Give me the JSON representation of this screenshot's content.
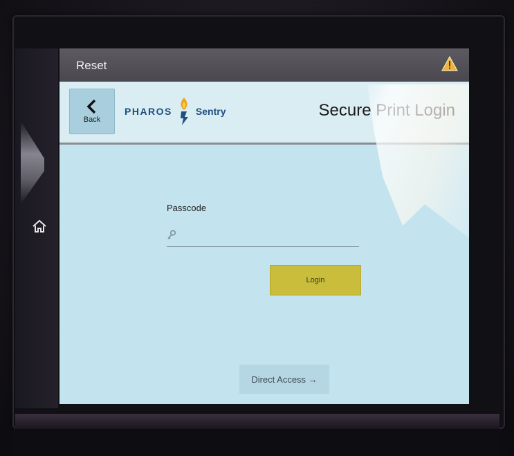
{
  "topbar": {
    "reset_label": "Reset",
    "warning_icon": "warning-triangle-icon"
  },
  "header": {
    "back_label": "Back",
    "back_icon": "chevron-left-icon",
    "logo": {
      "brand": "PHAROS",
      "product": "Sentry",
      "icon": "torch-icon"
    },
    "title": "Secure Print Login"
  },
  "form": {
    "passcode_label": "Passcode",
    "passcode_value": "",
    "passcode_icon": "key-icon",
    "login_label": "Login"
  },
  "footer": {
    "direct_access_label": "Direct Access →"
  },
  "side": {
    "home_icon": "home-icon"
  },
  "colors": {
    "screen_bg": "#c3e3ef",
    "topbar_bg": "#4a474f",
    "login_button": "#c9bd3b",
    "logo_blue": "#1f4f80"
  }
}
